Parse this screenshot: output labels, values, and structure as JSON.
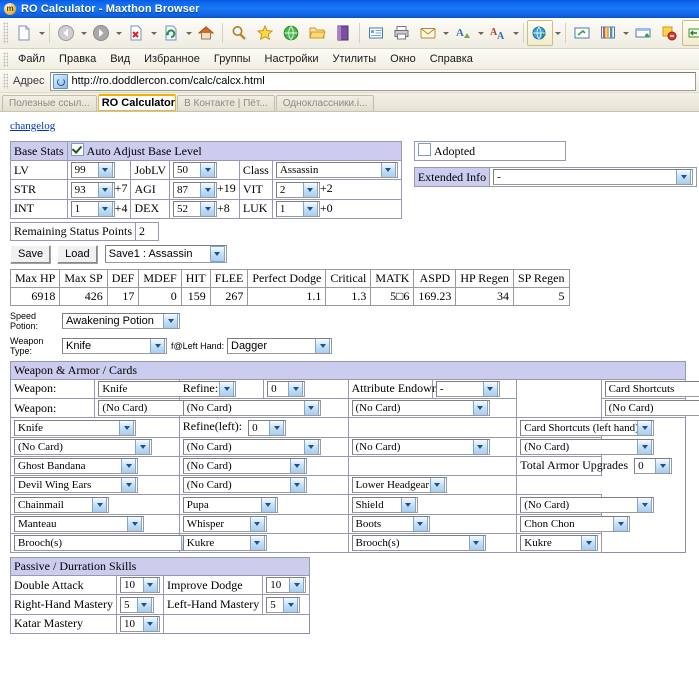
{
  "window": {
    "title": "RO Calculator  -  Maxthon Browser",
    "logo_icon": "maxthon-logo-icon"
  },
  "toolbar": {
    "buttons": [
      {
        "name": "new-tab-icon",
        "glyph": "page",
        "caret": true
      },
      {
        "name": "back-icon",
        "glyph": "back",
        "caret": true
      },
      {
        "name": "forward-icon",
        "glyph": "forward",
        "caret": true
      },
      {
        "name": "stop-icon",
        "glyph": "stop",
        "caret": true
      },
      {
        "name": "refresh-icon",
        "glyph": "refresh",
        "caret": true
      },
      {
        "name": "home-icon",
        "glyph": "home",
        "caret": false
      },
      {
        "name": "search-icon",
        "glyph": "magnifier",
        "caret": false
      },
      {
        "name": "favorites-icon",
        "glyph": "star",
        "caret": false
      },
      {
        "name": "globe-icon",
        "glyph": "globe-green",
        "caret": false
      },
      {
        "name": "folder-icon",
        "glyph": "folder",
        "caret": false
      },
      {
        "name": "book-icon",
        "glyph": "book",
        "caret": false
      },
      {
        "name": "list-icon",
        "glyph": "list",
        "caret": false
      },
      {
        "name": "print-icon",
        "glyph": "printer",
        "caret": false
      },
      {
        "name": "mail-icon",
        "glyph": "mail",
        "caret": true
      },
      {
        "name": "font-icon",
        "glyph": "font-a",
        "caret": true
      },
      {
        "name": "translate-icon",
        "glyph": "font-a2",
        "caret": true
      },
      {
        "name": "browse-globe-icon",
        "glyph": "globe-blue",
        "caret": true
      },
      {
        "name": "screenshot-icon",
        "glyph": "screen",
        "caret": false
      },
      {
        "name": "filter-icon",
        "glyph": "filter",
        "caret": true
      },
      {
        "name": "window-icon",
        "glyph": "window-plus",
        "caret": false
      },
      {
        "name": "block-ads-icon",
        "glyph": "block",
        "caret": false
      },
      {
        "name": "sniffer-icon",
        "glyph": "sniffer",
        "caret": true
      },
      {
        "name": "globe-close-icon",
        "glyph": "globe-x",
        "caret": false
      }
    ]
  },
  "menu": {
    "items": [
      "Файл",
      "Правка",
      "Вид",
      "Избранное",
      "Группы",
      "Настройки",
      "Утилиты",
      "Окно",
      "Справка"
    ]
  },
  "address": {
    "label": "Адрес",
    "value": "http://ro.doddlercon.com/calc/calcx.html",
    "icon": "page-globe-icon"
  },
  "tabs": [
    {
      "label": "Полезные ссыл...",
      "selected": false
    },
    {
      "label": "RO Calculator",
      "selected": true
    },
    {
      "label": "В Контакте | Пёт...",
      "selected": false
    },
    {
      "label": "Одноклассники.i...",
      "selected": false
    }
  ],
  "page": {
    "changelog_link": "changelog",
    "base_stats": {
      "header": "Base Stats",
      "auto_adjust_label": "Auto Adjust Base Level",
      "auto_adjust_checked": true,
      "lv_label": "LV",
      "lv_value": "99",
      "joblv_label": "JobLV",
      "joblv_value": "50",
      "class_label": "Class",
      "class_value": "Assassin",
      "rows": [
        {
          "name": "STR",
          "value": "93",
          "bonus": "+7",
          "name2": "AGI",
          "value2": "87",
          "bonus2": "+19",
          "name3": "VIT",
          "value3": "2",
          "bonus3": "+2"
        },
        {
          "name": "INT",
          "value": "1",
          "bonus": "+4",
          "name2": "DEX",
          "value2": "52",
          "bonus2": "+8",
          "name3": "LUK",
          "value3": "1",
          "bonus3": "+0"
        }
      ],
      "remaining_label": "Remaining Status Points",
      "remaining_value": "2"
    },
    "adopted": {
      "label": "Adopted",
      "checked": false
    },
    "extended_info": {
      "label": "Extended Info",
      "value": "-"
    },
    "save_load": {
      "save_label": "Save",
      "load_label": "Load",
      "slot_value": "Save1 : Assassin"
    },
    "stats_table": {
      "headers": [
        "Max HP",
        "Max SP",
        "DEF",
        "MDEF",
        "HIT",
        "FLEE",
        "Perfect Dodge",
        "Critical",
        "MATK",
        "ASPD",
        "HP Regen",
        "SP Regen"
      ],
      "values": [
        "6918",
        "426",
        "17",
        "0",
        "159",
        "267",
        "1.1",
        "1.3",
        "5□6",
        "169.23",
        "34",
        "5"
      ]
    },
    "speed_potion": {
      "label": "Speed Potion:",
      "value": "Awakening Potion"
    },
    "weapon_type": {
      "label": "Weapon Type:",
      "value": "Knife",
      "left_label": "f@Left Hand:",
      "left_value": "Dagger"
    },
    "weapon_armor": {
      "header": "Weapon & Armor / Cards",
      "rows": [
        {
          "c1_label": "Weapon:",
          "c1_value": "Knife",
          "c2_label": "Refine:",
          "c2_value": "0",
          "c3_label": "Attribute Endowment",
          "c3_value": "-",
          "c4_value": "Card Shortcuts"
        },
        {
          "c1_label": "Weapon:",
          "c1_value": "(No Card)",
          "c2_value": "(No Card)",
          "c3_value": "(No Card)",
          "c4_value": "(No Card)"
        },
        {
          "c1_value": "Knife",
          "c2_label": "Refine(left):",
          "c2_value": "0",
          "c4_value": "Card Shortcuts (left hand)"
        },
        {
          "c1_value": "(No Card)",
          "c2_value": "(No Card)",
          "c3_value": "(No Card)",
          "c4_value": "(No Card)"
        },
        {
          "c1_value": "Ghost Bandana",
          "c2_value": "(No Card)",
          "c4_label": "Total Armor Upgrades",
          "c4_value": "0"
        },
        {
          "c1_value": "Devil Wing Ears",
          "c2_value": "(No Card)",
          "c3_value": "Lower Headgear"
        },
        {
          "c1_value": "Chainmail",
          "c2_value": "Pupa",
          "c3_value": "Shield",
          "c4_value": "(No Card)"
        },
        {
          "c1_value": "Manteau",
          "c2_value": "Whisper",
          "c3_value": "Boots",
          "c4_value": "Chon Chon"
        },
        {
          "c1_value": "Brooch(s)",
          "c2_value": "Kukre",
          "c3_value": "Brooch(s)",
          "c4_value": "Kukre"
        }
      ]
    },
    "passive_skills": {
      "header": "Passive / Durration Skills",
      "rows": [
        {
          "label": "Double Attack",
          "value": "10",
          "label2": "Improve Dodge",
          "value2": "10"
        },
        {
          "label": "Right-Hand Mastery",
          "value": "5",
          "label2": "Left-Hand Mastery",
          "value2": "5"
        },
        {
          "label": "Katar Mastery",
          "value": "10"
        }
      ]
    }
  },
  "colors": {
    "titlebar": "#0b63ec",
    "panel_header": "#ccccee",
    "tab_selected_border": "#f0b400",
    "link": "#0033cc"
  }
}
